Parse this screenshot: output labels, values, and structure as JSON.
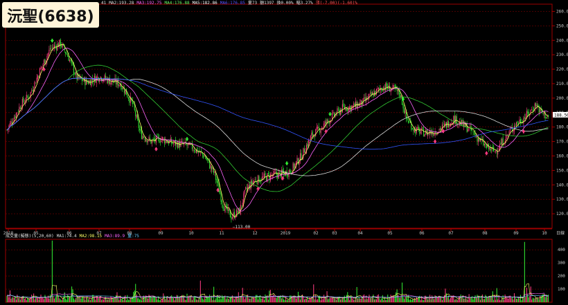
{
  "title": "沅聖(6638)",
  "ma_legend": [
    {
      "text": "41",
      "color": "#e0e0e0"
    },
    {
      "text": "MA2:193.28",
      "color": "#e0e0e0"
    },
    {
      "text": "MA3:192.75",
      "color": "#ff66ff"
    },
    {
      "text": "MA4:176.88",
      "color": "#66ff66"
    },
    {
      "text": "MA5:182.86",
      "color": "#ffffff"
    },
    {
      "text": "MA6:176.85",
      "color": "#5555ff"
    }
  ],
  "ohlc_legend": [
    {
      "text": "量73",
      "color": "#e0e0e0"
    },
    {
      "text": "額1397",
      "color": "#e0e0e0"
    },
    {
      "text": "換0.00%",
      "color": "#e0e0e0"
    },
    {
      "text": "幅3.27%",
      "color": "#e0e0e0"
    },
    {
      "text": "漲(-7.00)(-1.60)%",
      "color": "#ff5555"
    }
  ],
  "volume_legend": [
    {
      "text": "成交量(擬態)(5,20,60)",
      "color": "#e0e0e0"
    },
    {
      "text": "MA1:74.4",
      "color": "#e0e0e0"
    },
    {
      "text": "MA2:98.15",
      "color": "#ffff66"
    },
    {
      "text": "MA3:89.9",
      "color": "#ff66ff"
    },
    {
      "text": "量:75",
      "color": "#66ccff"
    }
  ],
  "colors": {
    "up": "#ff3c82",
    "down": "#33ee33",
    "grid": "#7a0000",
    "axis_text": "#cccccc"
  },
  "chart_data": [
    {
      "type": "candlestick",
      "ylim": [
        110,
        265
      ],
      "price_ticks": [
        "260.00",
        "250.00",
        "240.00",
        "230.00",
        "220.00",
        "210.00",
        "200.00",
        "190.00",
        "180.00",
        "170.00",
        "160.00",
        "150.00",
        "140.00",
        "130.00",
        "120.00"
      ],
      "last_price": "188.50",
      "x_tick_labels": [
        "2018",
        "05",
        "06",
        "07",
        "08",
        "09",
        "10",
        "11",
        "12",
        "2019",
        "02",
        "03",
        "04",
        "05",
        "06",
        "07",
        "08",
        "09",
        "10",
        "日線"
      ],
      "annotations": [
        {
          "text": "—113.00"
        }
      ],
      "close_path": [
        [
          0,
          178
        ],
        [
          14,
          196
        ],
        [
          22,
          202
        ],
        [
          32,
          219
        ],
        [
          42,
          234
        ],
        [
          52,
          238
        ],
        [
          60,
          228
        ],
        [
          68,
          214
        ],
        [
          78,
          211
        ],
        [
          90,
          215
        ],
        [
          100,
          212
        ],
        [
          110,
          210
        ],
        [
          114,
          206
        ],
        [
          122,
          196
        ],
        [
          130,
          175
        ],
        [
          140,
          170
        ],
        [
          150,
          172
        ],
        [
          160,
          169
        ],
        [
          170,
          168
        ],
        [
          180,
          166
        ],
        [
          192,
          160
        ],
        [
          202,
          147
        ],
        [
          210,
          126
        ],
        [
          218,
          118
        ],
        [
          226,
          122
        ],
        [
          232,
          136
        ],
        [
          240,
          143
        ],
        [
          250,
          145
        ],
        [
          260,
          147
        ],
        [
          270,
          148
        ],
        [
          276,
          150
        ],
        [
          286,
          160
        ],
        [
          296,
          174
        ],
        [
          306,
          180
        ],
        [
          316,
          187
        ],
        [
          326,
          193
        ],
        [
          336,
          194
        ],
        [
          346,
          197
        ],
        [
          356,
          203
        ],
        [
          366,
          208
        ],
        [
          376,
          206
        ],
        [
          382,
          203
        ],
        [
          388,
          186
        ],
        [
          396,
          178
        ],
        [
          406,
          176
        ],
        [
          416,
          177
        ],
        [
          426,
          181
        ],
        [
          434,
          186
        ],
        [
          442,
          182
        ],
        [
          450,
          178
        ],
        [
          458,
          172
        ],
        [
          466,
          166
        ],
        [
          474,
          163
        ],
        [
          482,
          170
        ],
        [
          488,
          176
        ],
        [
          494,
          182
        ],
        [
          500,
          185
        ],
        [
          508,
          190
        ],
        [
          514,
          196
        ],
        [
          518,
          191
        ],
        [
          527,
          186
        ]
      ],
      "n_bars": 527,
      "moving_averages": [
        {
          "name": "MA2",
          "color": "#ffff66",
          "window": 5
        },
        {
          "name": "MA3",
          "color": "#ff66ff",
          "window": 20
        },
        {
          "name": "MA4",
          "color": "#33cc33",
          "window": 60
        },
        {
          "name": "MA5",
          "color": "#dddddd",
          "window": 120
        },
        {
          "name": "MA6",
          "color": "#3355ff",
          "window": 240
        }
      ]
    },
    {
      "type": "bar",
      "name": "volume",
      "ylim": [
        0,
        480
      ],
      "y_ticks": [
        "400",
        "300",
        "200",
        "100"
      ],
      "spikes": [
        [
          44,
          470
        ],
        [
          63,
          120
        ],
        [
          125,
          140
        ],
        [
          188,
          165
        ],
        [
          201,
          118
        ],
        [
          229,
          110
        ],
        [
          298,
          136
        ],
        [
          340,
          116
        ],
        [
          384,
          150
        ],
        [
          476,
          108
        ],
        [
          503,
          460
        ],
        [
          509,
          120
        ]
      ]
    }
  ]
}
